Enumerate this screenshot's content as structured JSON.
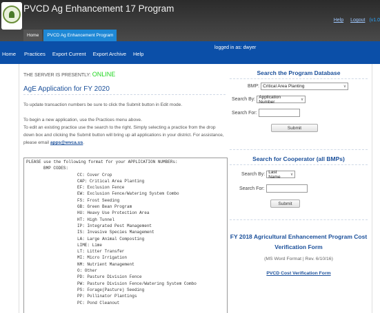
{
  "header": {
    "title": "PVCD Ag Enhancement 17 Program",
    "tabs": [
      "Home",
      "PVCD Ag Enhancement Program"
    ],
    "help_link": "Help",
    "logout_link": "Logout",
    "version": "(v1.0"
  },
  "nav": {
    "items": [
      "Home",
      "Practices",
      "Export Current",
      "Export Archive",
      "Help"
    ],
    "logged_in": "logged in as: dwyer"
  },
  "main": {
    "server_label": "THE SERVER IS PRESENTLY:",
    "server_status": "ONLINE",
    "heading": "AgE Application for FY 2020",
    "para1": "To update transaction numbers be sure to click the Submit button in Edit mode.",
    "para2": "To begin a new application, use the Practices menu above.",
    "para3": "To edit an existing practice use the search to the right. Simply selecting a practice from the drop down box and clicking the Submit button will bring up all applications in your district. For assistance, please email",
    "email": "apps@wvca.us",
    "email_suffix": ".",
    "codes_intro": "PLEASE use the following format for your APPLICATION NUMBERs:",
    "codes_header": "BMP CODES:",
    "codes": [
      "CC: Cover Crop",
      "CAP: Critical Area Planting",
      "EF: Exclusion Fence",
      "EW: Exclusion Fence/Watering System Combo",
      "FS: Frost Seeding",
      "GB: Green Bean Program",
      "HU: Heavy Use Protection Area",
      "HT: High Tunnel",
      "IP: Integrated Pest Management",
      "IS: Invasive Species Management",
      "LA: Large Animal Composting",
      "LIME: Lime",
      "LT: Litter Transfer",
      "MI: Micro Irrigation",
      "NM: Nutrient Management",
      "O: Other",
      "PD: Pasture Division Fence",
      "PW: Pasture Division Fence/Watering System Combo",
      "PS: Forage(Pasture) Seeding",
      "PP: Pollinator Plantings",
      "PC: Pond Cleanout"
    ]
  },
  "search_program": {
    "heading": "Search the Program Database",
    "bmp_label": "BMP:",
    "bmp_value": "Critical Area Planting",
    "search_by_label": "Search By:",
    "search_by_value": "Application Number",
    "search_for_label": "Search For:",
    "search_for_value": "",
    "submit_label": "Submit"
  },
  "search_cooperator": {
    "heading": "Search for Cooperator (all BMPs)",
    "search_by_label": "Search By:",
    "search_by_value": "Last Name",
    "search_for_label": "Search For:",
    "search_for_value": "",
    "submit_label": "Submit"
  },
  "cost_form": {
    "heading": "FY 2018 Agricultural Enhancement Program Cost Verification Form",
    "note": "(MS Word Format | Rev. 6/10/16)",
    "link": "PVCD Cost Verification Form"
  },
  "colors": {
    "nav_bg": "#0b4fa8",
    "online": "#1fd61f",
    "heading_blue": "#1a4f9a",
    "active_tab": "#1e88d6"
  }
}
